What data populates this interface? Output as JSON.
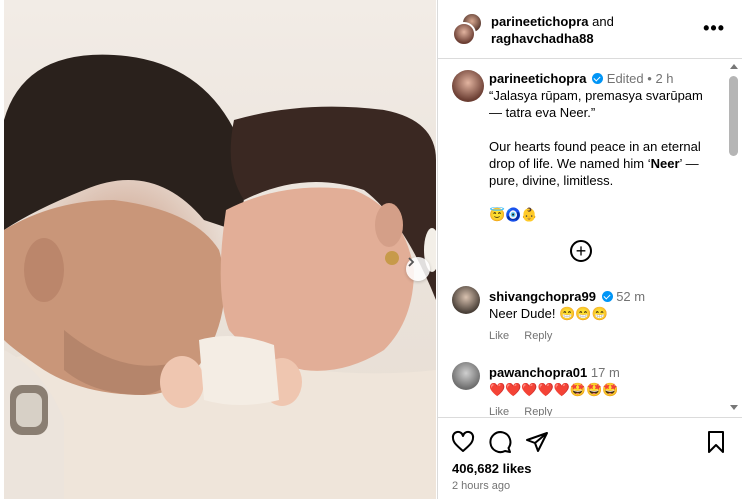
{
  "header": {
    "user1": "parineetichopra",
    "and_word": "and",
    "user2": "raghavchadha88",
    "more_label": "•••"
  },
  "caption": {
    "username": "parineetichopra",
    "edited": "Edited",
    "dot": "•",
    "time": "2 h",
    "line1": "“Jalasya rūpam, premasya svarūpam — tatra eva Neer.”",
    "line2_pre": "Our hearts found peace in an eternal drop of life. We named him ‘",
    "line2_bold": "Neer",
    "line2_post": "’ — pure, divine, limitless.",
    "emojis": "😇🧿👶"
  },
  "load_more_label": "+",
  "comments": [
    {
      "username": "shivangchopra99",
      "time": "52 m",
      "text": "Neer Dude! 😁😁😁",
      "like": "Like",
      "reply": "Reply"
    },
    {
      "username": "pawanchopra01",
      "time": "17 m",
      "text": "❤️❤️❤️❤️❤️🤩🤩🤩",
      "like": "Like",
      "reply": "Reply"
    }
  ],
  "footer": {
    "likes": "406,682 likes",
    "time": "2 hours ago"
  },
  "icons": {
    "like": "heart-icon",
    "comment": "comment-icon",
    "share": "send-icon",
    "save": "bookmark-icon",
    "next": "chevron-right-icon"
  },
  "colors": {
    "verified": "#0095f6",
    "muted": "#737373",
    "border": "#dbdbdb"
  }
}
